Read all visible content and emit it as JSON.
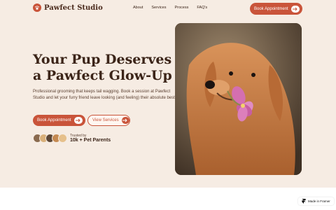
{
  "brand": {
    "name": "Pawfect Studio",
    "accent": "#c9543a"
  },
  "nav": {
    "links": [
      "About",
      "Services",
      "Process",
      "FAQ's"
    ],
    "cta": "Book Appointment"
  },
  "hero": {
    "title": "Your Pup Deserves a Pawfect Glow-Up",
    "description": "Professional grooming that keeps tail wagging. Book a session at Pawfect Studio and let your furry friend leave looking (and feeling) their absolute best.",
    "primary_cta": "Book Appointment",
    "secondary_cta": "View Services"
  },
  "trust": {
    "label": "Trusted by",
    "value": "10k + Pet Parents"
  },
  "image": {
    "subject": "golden retriever holding pink flower"
  },
  "badge": {
    "label": "Made in Framer"
  }
}
